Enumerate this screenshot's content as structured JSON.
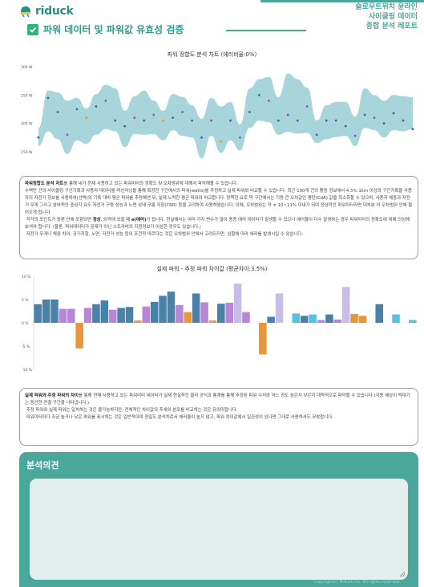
{
  "header": {
    "logo_text": "riduck",
    "meta_lines": [
      "슬로우트위치 윤라인",
      "사이클링 데이터",
      "종합 분석 레포트"
    ],
    "title": "파워 데이터 및 파워값 유효성 검증",
    "check_icon": "checkbox-checked-icon",
    "brand_color": "#4aa79b"
  },
  "chart_data": [
    {
      "type": "line",
      "title": "파워 정합도 분석 차트 (에러비율:0%)",
      "yticks": [
        "300 W",
        "250 W",
        "200 W",
        "150 W"
      ],
      "ylim": [
        140,
        310
      ],
      "band_color": "#a8d5dc",
      "band": {
        "upper": [
          192,
          258,
          255,
          240,
          245,
          226,
          252,
          268,
          262,
          222,
          248,
          258,
          240,
          222,
          252,
          247,
          232,
          208,
          245,
          230,
          238,
          198,
          262,
          278,
          282,
          246,
          288,
          278,
          263,
          205,
          232,
          238,
          238,
          212,
          262,
          250,
          240,
          250,
          248,
          246
        ],
        "lower": [
          160,
          186,
          172,
          146,
          170,
          164,
          180,
          190,
          186,
          158,
          181,
          180,
          181,
          170,
          188,
          178,
          175,
          138,
          178,
          148,
          170,
          152,
          192,
          205,
          202,
          180,
          185,
          182,
          183,
          165,
          172,
          176,
          178,
          160,
          192,
          188,
          175,
          188,
          186,
          190
        ]
      },
      "points": [
        {
          "i": 0,
          "v": 175,
          "c": "#2e6f93"
        },
        {
          "i": 1,
          "v": 245,
          "c": "#2e6f93"
        },
        {
          "i": 2,
          "v": 220,
          "c": "#2e6f93"
        },
        {
          "i": 3,
          "v": 180,
          "c": "#8f4fbf"
        },
        {
          "i": 4,
          "v": 225,
          "c": "#2e6f93"
        },
        {
          "i": 5,
          "v": 210,
          "c": "#e09a3c"
        },
        {
          "i": 6,
          "v": 230,
          "c": "#2e6f93"
        },
        {
          "i": 7,
          "v": 240,
          "c": "#8f4fbf"
        },
        {
          "i": 8,
          "v": 205,
          "c": "#2e6f93"
        },
        {
          "i": 9,
          "v": 195,
          "c": "#2e6f93"
        },
        {
          "i": 10,
          "v": 210,
          "c": "#8f4fbf"
        },
        {
          "i": 11,
          "v": 205,
          "c": "#2e6f93"
        },
        {
          "i": 12,
          "v": 215,
          "c": "#8f4fbf"
        },
        {
          "i": 13,
          "v": 205,
          "c": "#e09a3c"
        },
        {
          "i": 14,
          "v": 210,
          "c": "#2e6f93"
        },
        {
          "i": 15,
          "v": 220,
          "c": "#8f4fbf"
        },
        {
          "i": 16,
          "v": 205,
          "c": "#2e6f93"
        },
        {
          "i": 17,
          "v": 175,
          "c": "#2e6f93"
        },
        {
          "i": 18,
          "v": 205,
          "c": "#8f4fbf"
        },
        {
          "i": 19,
          "v": 168,
          "c": "#e09a3c"
        },
        {
          "i": 20,
          "v": 205,
          "c": "#2e6f93"
        },
        {
          "i": 21,
          "v": 175,
          "c": "#8f4fbf"
        },
        {
          "i": 22,
          "v": 220,
          "c": "#2e6f93"
        },
        {
          "i": 23,
          "v": 250,
          "c": "#2e6f93"
        },
        {
          "i": 24,
          "v": 240,
          "c": "#8f4fbf"
        },
        {
          "i": 25,
          "v": 205,
          "c": "#2e6f93"
        },
        {
          "i": 26,
          "v": 215,
          "c": "#8f4fbf"
        },
        {
          "i": 27,
          "v": 205,
          "c": "#2e6f93"
        },
        {
          "i": 28,
          "v": 230,
          "c": "#8f4fbf"
        },
        {
          "i": 29,
          "v": 180,
          "c": "#2e6f93"
        },
        {
          "i": 30,
          "v": 205,
          "c": "#2e6f93"
        },
        {
          "i": 31,
          "v": 205,
          "c": "#2e6f93"
        },
        {
          "i": 32,
          "v": 195,
          "c": "#2e6f93"
        },
        {
          "i": 33,
          "v": 178,
          "c": "#8f4fbf"
        },
        {
          "i": 34,
          "v": 215,
          "c": "#2e6f93"
        },
        {
          "i": 35,
          "v": 210,
          "c": "#8f4fbf"
        },
        {
          "i": 36,
          "v": 200,
          "c": "#2e6f93"
        },
        {
          "i": 37,
          "v": 218,
          "c": "#2e6f93"
        },
        {
          "i": 38,
          "v": 205,
          "c": "#2e6f93"
        },
        {
          "i": 39,
          "v": 190,
          "c": "#2e6f93"
        }
      ]
    },
    {
      "type": "bar",
      "title": "실제 파워 - 추정 파워 차이값 (평균차이:3.5%)",
      "yticks": [
        "10 %",
        "5 %",
        "0 %",
        "-5 %",
        "-10 %"
      ],
      "ylim": [
        -10,
        10
      ],
      "values": [
        4,
        5,
        5,
        3,
        3,
        -5.5,
        3.2,
        4,
        4.8,
        2.8,
        3.2,
        3.4,
        0.5,
        3.5,
        4.5,
        5.8,
        6.7,
        3.8,
        2.3,
        6.3,
        4.4,
        0.5,
        4.1,
        4.3,
        8.4,
        2.3,
        0,
        -6.8,
        1.3,
        6.3,
        0,
        2,
        1.5,
        1.8,
        0.6,
        1.8,
        0.7,
        7.7,
        1.9,
        1.5,
        0,
        4,
        0,
        1.8,
        0,
        0.6
      ],
      "colors": [
        "#4a81a8",
        "#4a81a8",
        "#4a81a8",
        "#b986d6",
        "#b986d6",
        "#e7963a",
        "#b986d6",
        "#4a81a8",
        "#4a81a8",
        "#b986d6",
        "#4a81a8",
        "#4a81a8",
        "#e7963a",
        "#b986d6",
        "#4a81a8",
        "#4a81a8",
        "#4a81a8",
        "#b986d6",
        "#e7963a",
        "#4a81a8",
        "#b986d6",
        "#e7963a",
        "#4a81a8",
        "#b986d6",
        "#c7bde6",
        "#b986d6",
        "#ffffff",
        "#e7963a",
        "#4a81a8",
        "#c7bde6",
        "#ffffff",
        "#55c0e0",
        "#4a81a8",
        "#55c0e0",
        "#b986d6",
        "#4a81a8",
        "#b986d6",
        "#c7bde6",
        "#e7963a",
        "#e7963a",
        "#ffffff",
        "#4a81a8",
        "#ffffff",
        "#55c0e0",
        "#ffffff",
        "#55c0e0"
      ]
    }
  ],
  "note1": {
    "lead": "파워정합도 분석 차트",
    "line1": "를 통해 내가 현재 사용하고 있는 파워미터의 정확도 및 오차범위에 대해서 파악해볼 수 있습니다.",
    "line2": "수백만 건의 사이클링 구간기록과 사용자 데이터를 머신러닝을 통해 특정한 구간에서의 파워(watts)를 추정하고 실제 파워와 비교할 수 있습니다. 최근 100개 건의 활동 정보에서 4.5% 1km 이상의 구간기록을 사용자의 자전거 정보를 사용하여(선택)의 기록 대비 평균 파워를 추정해낸 뒤, 실제 노력한 평균 파워와 비교합니다. 양쪽한 요로 먹 구간에서는 기량 큰 오차값인 평탄(CdA) 값을 최소화할 수 있으며, 사용자 체중과 자전거 무게 그리고 앞바퀴인 중심각 요도 자전거 구동 성능과 노면 상태 구름 저항(CRR) 등을 고려하여 사용하였습니다. 이때, 오차범위는 약 ± 10~11% 이내가 되며 정상적인 파워미터라면 대부분 이 오차범위 안에 들어오게 됩니다.",
    "line3a": "직각의 포인트가 좌편 안에 포함되면 ",
    "line3b": "정상",
    "line3c": ", 외곽에 있을 때 ",
    "line3d": "e(에러)",
    "line3e": "가 됩니다. 현실에서는 여러 가지 변수가 많아 종종 에러 데이터가 발생할 수 있으나 에러율이 다수 발생하는 경우 파워미터의 정확도에 대해 의심해보셔야 합니다. (물론, 파워데이터가 문제가 아닌 스트라버의 지원정보가 이상한 경우도 있습니다.)",
    "line4": "자전거 무게나 체중 차이, 공기저항, 노면, 자전거 성능 등의 조건적 따르다는 것은 오차범위 안에서 고려되지만, 심할에 따라 에러를 발생시킬 수 있습니다."
  },
  "note2": {
    "lead": "실제 파워와 추정 파워의 차이",
    "line1": "를 통해 현재 사용하고 있는 파워미터 데이터가 실제 현실적인 물리 공식과 통계를 통해 추정된 파워 수치와 어느 정도 높은지 낮은지 대략적으로 파악할 수 있습니다 (각종 예상이 떡대기는 동안한 연결 구간을 나타냅니다.)",
    "line2": "추정 파워와 실제 파워는 일치하는 것은 불가능하지만, 전체적인 차이값의 추세와 분포를 비교하는 것은 유의미합니다.",
    "line3": "파워미터마다 조금 높거나 낮은 파워를 표시하는 것은 일반적이며 정밀도 분석치로서 에러율이 높지 않고, 파워 차이값에서 일관성이 있다면 그대로 사용하셔도 무방합니다."
  },
  "opinion": {
    "title": "분석의견",
    "value": "",
    "copyright": "Copyright(c) Riduck Inc. All rights reserved."
  }
}
